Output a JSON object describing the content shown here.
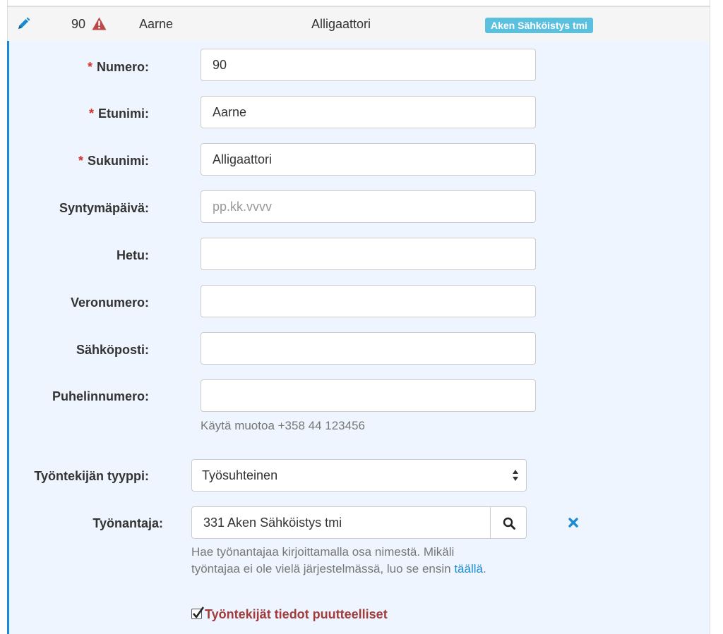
{
  "summary": {
    "number": "90",
    "first_name": "Aarne",
    "last_name": "Alligaattori",
    "employer_badge": "Aken Sähköistys tmi"
  },
  "form": {
    "number": {
      "label": "Numero:",
      "value": "90",
      "required": true
    },
    "first_name": {
      "label": "Etunimi:",
      "value": "Aarne",
      "required": true
    },
    "last_name": {
      "label": "Sukunimi:",
      "value": "Alligaattori",
      "required": true
    },
    "birth_date": {
      "label": "Syntymäpäivä:",
      "value": "",
      "placeholder": "pp.kk.vvvv"
    },
    "ssn": {
      "label": "Hetu:",
      "value": ""
    },
    "tax_number": {
      "label": "Veronumero:",
      "value": ""
    },
    "email": {
      "label": "Sähköposti:",
      "value": ""
    },
    "phone": {
      "label": "Puhelinnumero:",
      "value": "",
      "help": "Käytä muotoa +358 44 123456"
    },
    "employee_type": {
      "label": "Työntekijän tyyppi:",
      "selected": "Työsuhteinen"
    },
    "employer": {
      "label": "Työnantaja:",
      "value": "331 Aken Sähköistys tmi",
      "help_prefix": "Hae työnantajaa kirjoittamalla osa nimestä. Mikäli",
      "help_middle": "työntajaa ei ole vielä järjestelmässä, luo se ensin",
      "help_link": "täällä",
      "help_suffix": "."
    },
    "incomplete_checkbox": {
      "label": "Työntekijät tiedot puutteelliset",
      "checked": true
    }
  },
  "required_mark": "*",
  "colors": {
    "accent": "#1b8cd1",
    "badge": "#5bc0de",
    "warning": "#b94a48",
    "required": "#d9302b",
    "panel_bg": "#eef5fe"
  },
  "icons": {
    "edit": "pencil-icon",
    "warning": "warning-triangle-icon",
    "search": "search-icon",
    "clear": "close-icon",
    "select": "select-arrows-icon",
    "checkbox": "checkmark-icon"
  }
}
